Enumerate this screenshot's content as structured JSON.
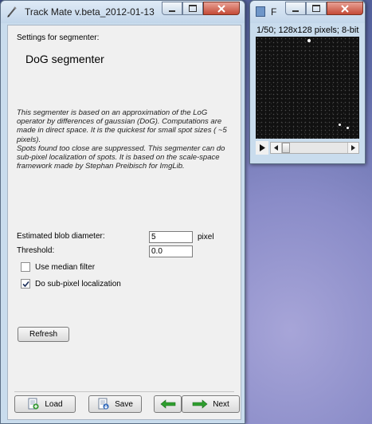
{
  "main_window": {
    "title": "Track Mate v.beta_2012-01-13",
    "settings_label": "Settings for segmenter:",
    "segmenter_name": "DoG segmenter",
    "description_p1": "This segmenter is based on an approximation of the LoG operator by differences of gaussian (DoG). Computations are made in direct space. It is the quickest for small spot sizes ( ~5 pixels).",
    "description_p2": "Spots found too close are suppressed. This segmenter can do sub-pixel localization of spots. It is based on the scale-space framework made by Stephan Preibisch for ImgLib.",
    "blob_diameter_label": "Estimated blob diameter:",
    "blob_diameter_value": "5",
    "blob_diameter_unit": "pixel",
    "threshold_label": "Threshold:",
    "threshold_value": "0.0",
    "median_filter_label": "Use median filter",
    "median_filter_checked": false,
    "subpixel_label": "Do sub-pixel localization",
    "subpixel_checked": true,
    "refresh_label": "Refresh",
    "load_label": "Load",
    "save_label": "Save",
    "next_label": "Next"
  },
  "image_window": {
    "title": "F",
    "info": "1/50; 128x128 pixels; 8-bit"
  },
  "colors": {
    "arrow_green": "#2e9e2e",
    "panel_bg": "#f0f0f0",
    "frame_blue": "#c9dced",
    "close_red": "#c44a36"
  },
  "icons": [
    "imagej-pen-icon",
    "minimize-icon",
    "maximize-icon",
    "close-icon",
    "load-icon",
    "save-icon",
    "arrow-left-icon",
    "arrow-right-icon",
    "play-icon",
    "scroll-left-icon",
    "scroll-right-icon",
    "image-icon"
  ]
}
